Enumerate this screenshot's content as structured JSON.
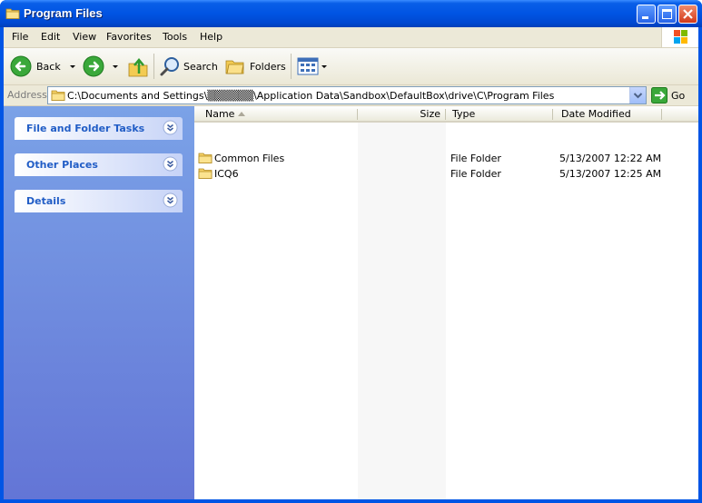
{
  "window": {
    "title": "Program Files"
  },
  "menu": {
    "file": "File",
    "edit": "Edit",
    "view": "View",
    "favorites": "Favorites",
    "tools": "Tools",
    "help": "Help"
  },
  "toolbar": {
    "back": "Back",
    "search": "Search",
    "folders": "Folders"
  },
  "address": {
    "label": "Address",
    "path": "C:\\Documents and Settings\\▒▒▒▒▒▒\\Application Data\\Sandbox\\DefaultBox\\drive\\C\\Program Files",
    "go": "Go"
  },
  "tasks": [
    {
      "title": "File and Folder Tasks"
    },
    {
      "title": "Other Places"
    },
    {
      "title": "Details"
    }
  ],
  "columns": {
    "name": "Name",
    "size": "Size",
    "type": "Type",
    "date": "Date Modified"
  },
  "files": [
    {
      "name": "Common Files",
      "size": "",
      "type": "File Folder",
      "date": "5/13/2007 12:22 AM"
    },
    {
      "name": "ICQ6",
      "size": "",
      "type": "File Folder",
      "date": "5/13/2007 12:25 AM"
    }
  ],
  "colors": {
    "title_bar": "#0054e3",
    "task_title": "#215dc6",
    "left_pane_top": "#7ba2e7",
    "left_pane_bottom": "#6375d6"
  }
}
